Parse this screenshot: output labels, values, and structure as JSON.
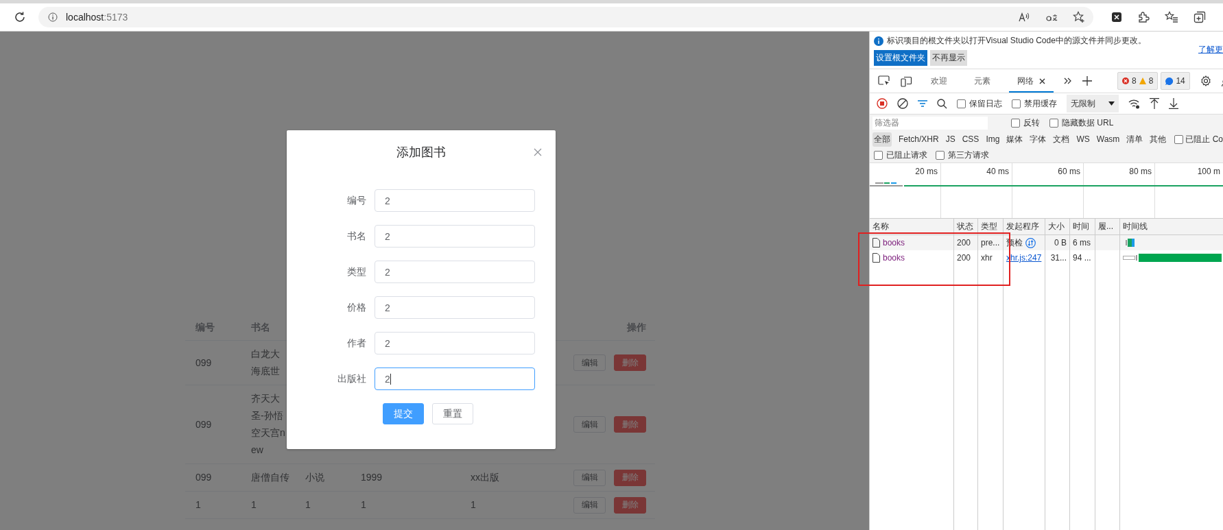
{
  "browser": {
    "url_host": "localhost",
    "url_port": ":5173"
  },
  "table": {
    "columns": [
      "编号",
      "书名"
    ],
    "action_column": "操作",
    "rows": [
      {
        "cells": [
          [
            "099"
          ],
          [
            "白龙大",
            "海底世"
          ]
        ],
        "actions": [
          {
            "label": "编辑",
            "kind": "default"
          },
          {
            "label": "删除",
            "kind": "danger"
          }
        ]
      },
      {
        "cells": [
          [
            "099"
          ],
          [
            "齐天大",
            "圣-孙悟",
            "空天宫n",
            "ew"
          ]
        ],
        "actions": [
          {
            "label": "编辑",
            "kind": "default"
          },
          {
            "label": "删除",
            "kind": "danger"
          }
        ]
      },
      {
        "cells": [
          [
            "099"
          ],
          [
            "唐僧自传"
          ],
          [
            "小说"
          ],
          [
            "1999"
          ],
          [
            "xx出版"
          ]
        ],
        "actions": [
          {
            "label": "编辑",
            "kind": "default"
          },
          {
            "label": "删除",
            "kind": "danger"
          }
        ]
      },
      {
        "cells": [
          [
            "1"
          ],
          [
            "1"
          ],
          [
            "1"
          ],
          [
            "1"
          ],
          [
            "1"
          ]
        ],
        "actions": [
          {
            "label": "编辑",
            "kind": "default"
          },
          {
            "label": "删除",
            "kind": "danger"
          }
        ]
      }
    ]
  },
  "dialog": {
    "title": "添加图书",
    "fields": [
      {
        "label": "编号",
        "value": "2",
        "focused": false
      },
      {
        "label": "书名",
        "value": "2",
        "focused": false
      },
      {
        "label": "类型",
        "value": "2",
        "focused": false
      },
      {
        "label": "价格",
        "value": "2",
        "focused": false
      },
      {
        "label": "作者",
        "value": "2",
        "focused": false
      },
      {
        "label": "出版社",
        "value": "2",
        "focused": true
      }
    ],
    "buttons": [
      {
        "label": "提交",
        "kind": "primary"
      },
      {
        "label": "重置",
        "kind": "default"
      }
    ]
  },
  "devtools": {
    "infobar": {
      "text": "标识项目的根文件夹以打开Visual Studio Code中的源文件并同步更改。",
      "link": "了解更",
      "buttons": [
        {
          "label": "设置根文件夹",
          "kind": "primary"
        },
        {
          "label": "不再显示",
          "kind": "secondary"
        }
      ]
    },
    "tabs": [
      {
        "label": "欢迎",
        "selected": false,
        "closable": false
      },
      {
        "label": "元素",
        "selected": false,
        "closable": false
      },
      {
        "label": "网络",
        "selected": true,
        "closable": true
      }
    ],
    "issues": {
      "errors": "8",
      "warnings": "8",
      "messages": "14"
    },
    "toolbar": {
      "checkboxes": [
        {
          "label": "保留日志",
          "checked": false
        },
        {
          "label": "禁用缓存",
          "checked": false
        }
      ],
      "throttling": "无限制"
    },
    "filter": {
      "placeholder": "筛选器",
      "checkboxes": [
        {
          "label": "反转",
          "checked": false
        },
        {
          "label": "隐藏数据 URL",
          "checked": false
        }
      ]
    },
    "types": [
      {
        "label": "全部",
        "selected": true
      },
      {
        "label": "Fetch/XHR",
        "selected": false
      },
      {
        "label": "JS",
        "selected": false
      },
      {
        "label": "CSS",
        "selected": false
      },
      {
        "label": "Img",
        "selected": false
      },
      {
        "label": "媒体",
        "selected": false
      },
      {
        "label": "字体",
        "selected": false
      },
      {
        "label": "文档",
        "selected": false
      },
      {
        "label": "WS",
        "selected": false
      },
      {
        "label": "Wasm",
        "selected": false
      },
      {
        "label": "清单",
        "selected": false
      },
      {
        "label": "其他",
        "selected": false
      }
    ],
    "blocked_cookies": {
      "label": "已阻止 Co",
      "checked": false
    },
    "extra_checkboxes": [
      {
        "label": "已阻止请求",
        "checked": false
      },
      {
        "label": "第三方请求",
        "checked": false
      }
    ],
    "overview_ticks": [
      "20 ms",
      "40 ms",
      "60 ms",
      "80 ms",
      "100 m"
    ],
    "columns": [
      "名称",
      "状态",
      "类型",
      "发起程序",
      "大小",
      "时间",
      "履...",
      "时间线"
    ],
    "requests": [
      {
        "name": "books",
        "status": "200",
        "type": "pre...",
        "initiator": "预检",
        "kind": "preflight",
        "size": "0 B",
        "time": "6 ms"
      },
      {
        "name": "books",
        "status": "200",
        "type": "xhr",
        "initiator": "xhr.js:247",
        "kind": "link",
        "size": "31...",
        "time": "94 ..."
      }
    ]
  }
}
